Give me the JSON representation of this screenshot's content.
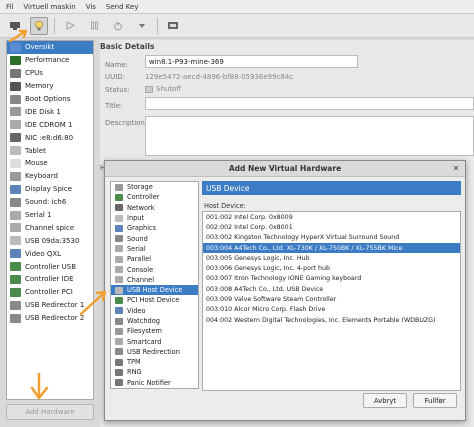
{
  "menubar": {
    "items": [
      "Fil",
      "Virtuell maskin",
      "Vis",
      "Send Key"
    ]
  },
  "toolbar": {
    "buttons": [
      "monitor-icon",
      "lightbulb-icon",
      "play-icon",
      "pause-icon",
      "power-icon",
      "snapshot-icon"
    ]
  },
  "sidebar": {
    "items": [
      {
        "label": "Oversikt",
        "color": "#5b8bd0",
        "selected": true
      },
      {
        "label": "Performance",
        "color": "#2a6e2a"
      },
      {
        "label": "CPUs",
        "color": "#777777"
      },
      {
        "label": "Memory",
        "color": "#555555"
      },
      {
        "label": "Boot Options",
        "color": "#888888"
      },
      {
        "label": "IDE Disk 1",
        "color": "#999999"
      },
      {
        "label": "IDE CDROM 1",
        "color": "#aaaaaa"
      },
      {
        "label": "NIC :e8:d6:80",
        "color": "#666666"
      },
      {
        "label": "Tablet",
        "color": "#bbbbbb"
      },
      {
        "label": "Mouse",
        "color": "#dddddd"
      },
      {
        "label": "Keyboard",
        "color": "#999999"
      },
      {
        "label": "Display Spice",
        "color": "#5c84b8"
      },
      {
        "label": "Sound: ich6",
        "color": "#888888"
      },
      {
        "label": "Serial 1",
        "color": "#aaaaaa"
      },
      {
        "label": "Channel spice",
        "color": "#aaaaaa"
      },
      {
        "label": "USB 09da:3530",
        "color": "#bbbbbb"
      },
      {
        "label": "Video QXL",
        "color": "#5c84b8"
      },
      {
        "label": "Controller USB",
        "color": "#4a8a4a"
      },
      {
        "label": "Controller IDE",
        "color": "#4a8a4a"
      },
      {
        "label": "Controller PCI",
        "color": "#4a8a4a"
      },
      {
        "label": "USB Redirector 1",
        "color": "#8a8a8a"
      },
      {
        "label": "USB Redirector 2",
        "color": "#8a8a8a"
      }
    ],
    "add_hardware_label": "Add Hardware"
  },
  "details": {
    "title": "Basic Details",
    "name_label": "Name:",
    "name_value": "win8.1-P93-mine-369",
    "uuid_label": "UUID:",
    "uuid_value": "129e5472-aecd-4896-bf88-05936e99c84c",
    "status_label": "Status:",
    "status_value": "Shutoff",
    "title_label": "Title:",
    "description_label": "Description:",
    "partial_label": "H"
  },
  "dialog": {
    "title": "Add New Virtual Hardware",
    "categories": [
      {
        "label": "Storage",
        "color": "#999999"
      },
      {
        "label": "Controller",
        "color": "#4a8a4a"
      },
      {
        "label": "Network",
        "color": "#666666"
      },
      {
        "label": "Input",
        "color": "#bbbbbb"
      },
      {
        "label": "Graphics",
        "color": "#5c84b8"
      },
      {
        "label": "Sound",
        "color": "#888888"
      },
      {
        "label": "Serial",
        "color": "#aaaaaa"
      },
      {
        "label": "Parallel",
        "color": "#aaaaaa"
      },
      {
        "label": "Console",
        "color": "#aaaaaa"
      },
      {
        "label": "Channel",
        "color": "#aaaaaa"
      },
      {
        "label": "USB Host Device",
        "color": "#bbbbbb",
        "selected": true
      },
      {
        "label": "PCI Host Device",
        "color": "#4a8a4a"
      },
      {
        "label": "Video",
        "color": "#5c84b8"
      },
      {
        "label": "Watchdog",
        "color": "#888888"
      },
      {
        "label": "Filesystem",
        "color": "#999999"
      },
      {
        "label": "Smartcard",
        "color": "#aaaaaa"
      },
      {
        "label": "USB Redirection",
        "color": "#8a8a8a"
      },
      {
        "label": "TPM",
        "color": "#777777"
      },
      {
        "label": "RNG",
        "color": "#777777"
      },
      {
        "label": "Panic Notifier",
        "color": "#777777"
      }
    ],
    "section_title": "USB Device",
    "host_device_label": "Host Device:",
    "devices": [
      {
        "label": "001:002 Intel Corp. 0x8009"
      },
      {
        "label": "002:002 Intel Corp. 0x8001"
      },
      {
        "label": "003:002 Kingston Technology HyperX Virtual Surround Sound"
      },
      {
        "label": "003:004 A4Tech Co., Ltd. XL-730K / XL-750BK / XL-755BK Mice",
        "selected": true
      },
      {
        "label": "003:005 Genesys Logic, Inc. Hub"
      },
      {
        "label": "003:006 Genesys Logic, Inc. 4-port hub"
      },
      {
        "label": "003:007 Itron Technology iONE Gaming keyboard"
      },
      {
        "label": "003:008 A4Tech Co., Ltd. USB Device"
      },
      {
        "label": "003:009 Valve Software Steam Controller"
      },
      {
        "label": "003:010 Alcor Micro Corp. Flash Drive"
      },
      {
        "label": "004:002 Western Digital Technologies, Inc. Elements Portable (WDBUZG)"
      }
    ],
    "cancel_label": "Avbryt",
    "finish_label": "Fullfør"
  }
}
